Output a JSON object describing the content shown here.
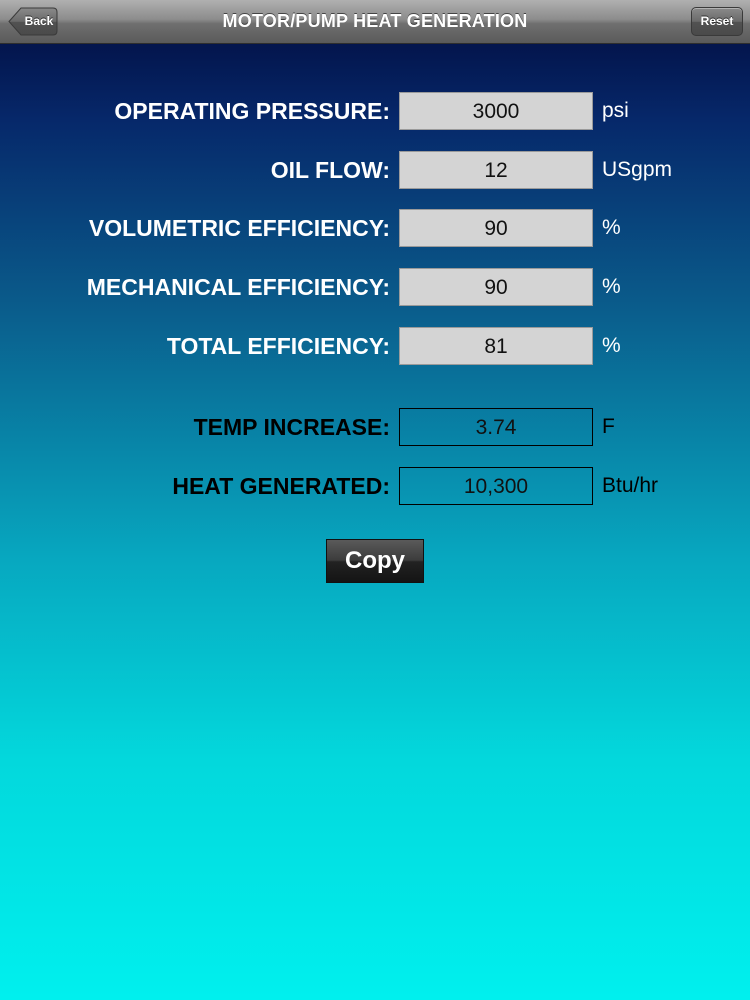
{
  "header": {
    "title": "MOTOR/PUMP HEAT GENERATION",
    "back_label": "Back",
    "reset_label": "Reset"
  },
  "inputs": [
    {
      "label": "OPERATING PRESSURE:",
      "value": "3000",
      "unit": "psi"
    },
    {
      "label": "OIL FLOW:",
      "value": "12",
      "unit": "USgpm"
    },
    {
      "label": "VOLUMETRIC EFFICIENCY:",
      "value": "90",
      "unit": "%"
    },
    {
      "label": "MECHANICAL EFFICIENCY:",
      "value": "90",
      "unit": "%"
    },
    {
      "label": "TOTAL EFFICIENCY:",
      "value": "81",
      "unit": "%"
    }
  ],
  "outputs": [
    {
      "label": "TEMP INCREASE:",
      "value": "3.74",
      "unit": "F"
    },
    {
      "label": "HEAT GENERATED:",
      "value": "10,300",
      "unit": "Btu/hr"
    }
  ],
  "actions": {
    "copy_label": "Copy"
  },
  "colors": {
    "background_top": "#020a3c",
    "background_bottom": "#00f0ee",
    "input_field_bg": "#d4d4d4"
  }
}
